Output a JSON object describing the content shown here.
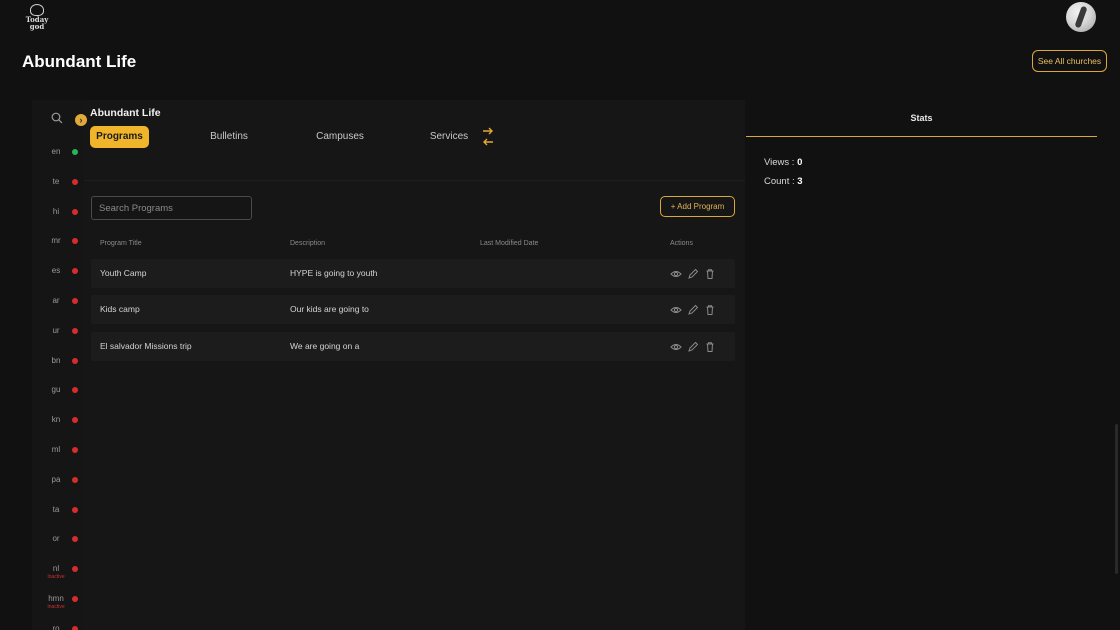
{
  "header": {
    "logo_line1": "Today",
    "logo_line2": "god"
  },
  "page": {
    "title": "Abundant Life",
    "see_all_label": "See All churches"
  },
  "languages": [
    {
      "code": "en",
      "status": "ok"
    },
    {
      "code": "te",
      "status": "missing"
    },
    {
      "code": "hi",
      "status": "missing"
    },
    {
      "code": "mr",
      "status": "missing"
    },
    {
      "code": "es",
      "status": "missing"
    },
    {
      "code": "ar",
      "status": "missing"
    },
    {
      "code": "ur",
      "status": "missing"
    },
    {
      "code": "bn",
      "status": "missing"
    },
    {
      "code": "gu",
      "status": "missing"
    },
    {
      "code": "kn",
      "status": "missing"
    },
    {
      "code": "ml",
      "status": "missing"
    },
    {
      "code": "pa",
      "status": "missing"
    },
    {
      "code": "ta",
      "status": "missing"
    },
    {
      "code": "or",
      "status": "missing"
    },
    {
      "code": "nl",
      "status": "missing",
      "note": "Inactive"
    },
    {
      "code": "hmn",
      "status": "missing",
      "note": "Inactive"
    },
    {
      "code": "ro",
      "status": "missing"
    }
  ],
  "content": {
    "church_name": "Abundant Life",
    "tabs": [
      {
        "label": "Programs",
        "active": true
      },
      {
        "label": "Bulletins",
        "active": false
      },
      {
        "label": "Campuses",
        "active": false
      },
      {
        "label": "Services",
        "active": false
      }
    ],
    "search_placeholder": "Search Programs",
    "add_label": "+  Add Program",
    "columns": [
      "Program Title",
      "Description",
      "Last Modified Date",
      "Actions"
    ],
    "rows": [
      {
        "title": "Youth Camp",
        "description": "HYPE is going to youth",
        "modified": ""
      },
      {
        "title": "Kids camp",
        "description": "Our kids are going to",
        "modified": ""
      },
      {
        "title": "El salvador Missions trip",
        "description": "We are going on a",
        "modified": ""
      }
    ]
  },
  "stats": {
    "heading": "Stats",
    "views_label": "Views : ",
    "views_value": "0",
    "count_label": "Count : ",
    "count_value": "3"
  },
  "colors": {
    "accent": "#f1b52c",
    "ok": "#28b45a",
    "missing": "#d82c2c",
    "background": "#111111"
  },
  "icons": [
    "search-icon",
    "chevron-right-icon",
    "swap-arrows-icon",
    "eye-icon",
    "pencil-icon",
    "trash-icon"
  ]
}
